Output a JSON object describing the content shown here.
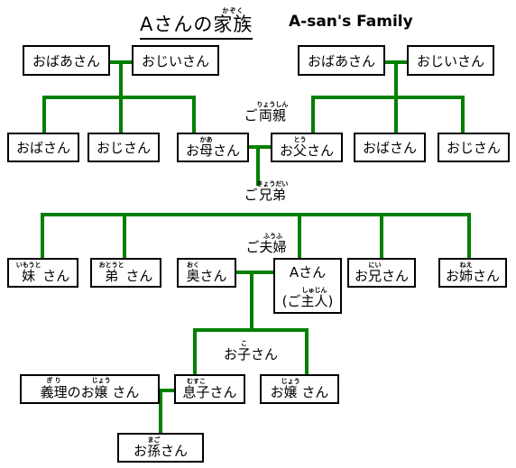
{
  "title": {
    "japanese": "Aさんの家族",
    "japanese_base": "Aさんの",
    "japanese_kanji": "家族",
    "japanese_furigana": "かぞく",
    "english": "A-san's Family"
  },
  "colors": {
    "line": "#008000",
    "box_border": "#000000",
    "text": "#000000",
    "background": "#ffffff"
  },
  "group_labels": {
    "parents": {
      "prefix": "ご",
      "kanji": "両親",
      "furigana": "りょうしん"
    },
    "siblings": {
      "prefix": "ご",
      "kanji": "兄弟",
      "furigana": "きょうだい"
    },
    "couple": {
      "prefix": "ご",
      "kanji": "夫婦",
      "furigana": "ふうふ"
    },
    "children": {
      "prefix": "お",
      "kanji": "子",
      "furigana": "こ",
      "suffix": "さん"
    }
  },
  "generations": {
    "grandparents_maternal": [
      {
        "label": "おばあさん",
        "kanji": "",
        "furigana": "",
        "role": "maternal-grandmother"
      },
      {
        "label": "おじいさん",
        "kanji": "",
        "furigana": "",
        "role": "maternal-grandfather"
      }
    ],
    "grandparents_paternal": [
      {
        "label": "おばあさん",
        "kanji": "",
        "furigana": "",
        "role": "paternal-grandmother"
      },
      {
        "label": "おじいさん",
        "kanji": "",
        "furigana": "",
        "role": "paternal-grandfather"
      }
    ],
    "parents_row": [
      {
        "label": "おばさん",
        "role": "maternal-aunt"
      },
      {
        "label": "おじさん",
        "role": "maternal-uncle"
      },
      {
        "prefix": "お",
        "kanji": "母",
        "furigana": "かあ",
        "suffix": "さん",
        "role": "mother"
      },
      {
        "prefix": "お",
        "kanji": "父",
        "furigana": "とう",
        "suffix": "さん",
        "role": "father"
      },
      {
        "label": "おばさん",
        "role": "paternal-aunt"
      },
      {
        "label": "おじさん",
        "role": "paternal-uncle"
      }
    ],
    "siblings_row": [
      {
        "prefix": "",
        "kanji": "妹",
        "furigana": "いもうと",
        "suffix": " さん",
        "role": "younger-sister"
      },
      {
        "prefix": "",
        "kanji": "弟",
        "furigana": "おとうと",
        "suffix": " さん",
        "role": "younger-brother"
      },
      {
        "prefix": "",
        "kanji": "奥",
        "furigana": "おく",
        "suffix": "さん",
        "role": "wife"
      },
      {
        "line1": "Aさん",
        "prefix": "(ご",
        "kanji": "主人",
        "furigana": "しゅじん",
        "suffix": ")",
        "role": "a-san-husband"
      },
      {
        "prefix": "お",
        "kanji": "兄",
        "furigana": "にい",
        "suffix": "さん",
        "role": "older-brother"
      },
      {
        "prefix": "お",
        "kanji": "姉",
        "furigana": "ねえ",
        "suffix": "さん",
        "role": "older-sister"
      }
    ],
    "children_row": [
      {
        "prefix": "義理のお",
        "kanji": "嬢",
        "furigana": "じょう",
        "furigana2": "ぎ り",
        "kanji2": "義理",
        "suffix": " さん",
        "role": "daughter-in-law",
        "full": "義理のお嬢さん"
      },
      {
        "prefix": "",
        "kanji": "息子",
        "furigana": "むすこ",
        "suffix": "さん",
        "role": "son"
      },
      {
        "prefix": "お",
        "kanji": "嬢",
        "furigana": "じょう",
        "suffix": " さん",
        "role": "daughter"
      }
    ],
    "grandchild_row": [
      {
        "prefix": "お",
        "kanji": "孫",
        "furigana": "まご",
        "suffix": "さん",
        "role": "grandchild"
      }
    ]
  }
}
